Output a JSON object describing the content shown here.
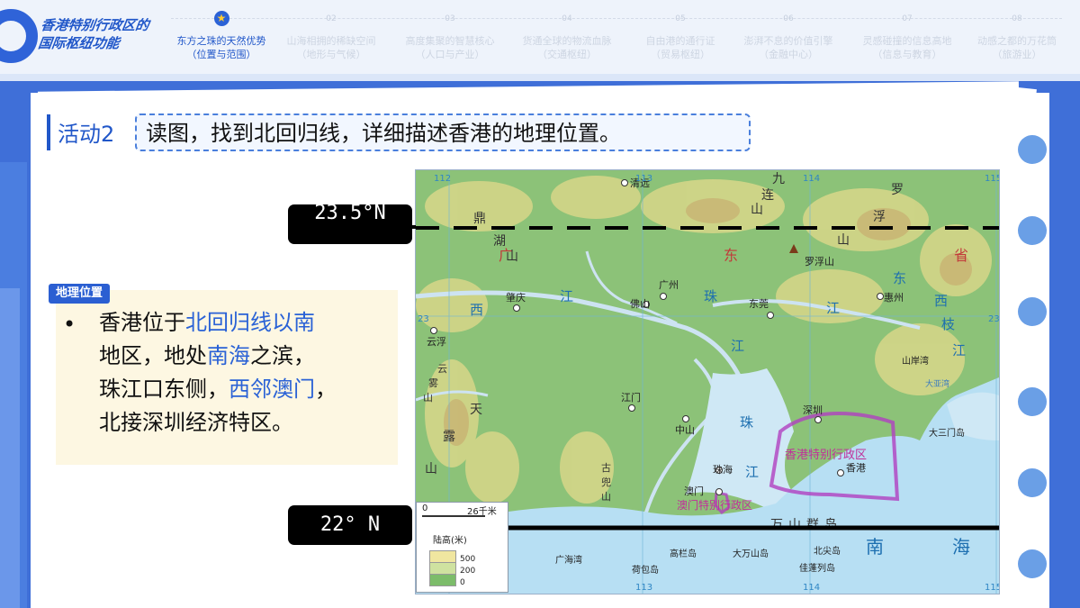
{
  "logo": {
    "text": "香港特别行政区的国际枢纽功能"
  },
  "nav": [
    {
      "num": "",
      "title": "东方之珠的天然优势",
      "sub": "（位置与范围）",
      "active": true
    },
    {
      "num": "02",
      "title": "山海相拥的稀缺空间",
      "sub": "（地形与气候）"
    },
    {
      "num": "03",
      "title": "高度集聚的智慧核心",
      "sub": "（人口与产业）"
    },
    {
      "num": "04",
      "title": "货通全球的物流血脉",
      "sub": "（交通枢纽）"
    },
    {
      "num": "05",
      "title": "自由港的通行证",
      "sub": "（贸易枢纽）"
    },
    {
      "num": "06",
      "title": "澎湃不息的价值引擎",
      "sub": "（金融中心）"
    },
    {
      "num": "07",
      "title": "灵感碰撞的信息高地",
      "sub": "（信息与教育）"
    },
    {
      "num": "08",
      "title": "动感之都的万花筒",
      "sub": "（旅游业）"
    }
  ],
  "activity": {
    "label": "活动2",
    "text": "读图，找到北回归线，详细描述香港的地理位置。"
  },
  "geo": {
    "tag": "地理位置",
    "bullet": "•",
    "line1_a": "香港位于",
    "line1_b": "北回归线以南",
    "line2_a": "地区，地处",
    "line2_b": "南海",
    "line2_c": "之滨，",
    "line3_a": "珠江口东侧，",
    "line3_b": "西邻澳门",
    "line3_c": "，",
    "line4": "北接深圳经济特区。"
  },
  "labels": {
    "tropic": "23.5°N",
    "lat22": "22° N"
  },
  "map": {
    "cities": [
      "清远",
      "广州",
      "佛山",
      "肇庆",
      "东莞",
      "惠州",
      "深圳",
      "香港",
      "江门",
      "中山",
      "珠海",
      "澳门",
      "云浮"
    ],
    "mountain": "罗浮山",
    "big": {
      "guang": "广",
      "dong": "东",
      "sheng": "省",
      "xi1": "西",
      "jiang1": "江",
      "zhu": "珠",
      "jiang2": "江",
      "zhu2": "珠",
      "jiang3": "江",
      "nan": "南",
      "hai": "海",
      "xi2": "西",
      "zhi": "枝",
      "jiang4": "江",
      "dong2": "东",
      "jiang5": "江",
      "shan": "山",
      "hu": "湖",
      "ding": "鼎",
      "jiu": "九",
      "lian": "连",
      "shan2": "山",
      "luo": "罗",
      "fu": "浮",
      "shan3": "山",
      "yun": "云",
      "wu": "雾",
      "shan4": "山",
      "tian": "天",
      "lu": "露",
      "shan5": "山",
      "gu": "古",
      "dou": "兜",
      "shan6": "山",
      "wan": "万",
      "shan7": "山",
      "qun": "群",
      "dao": "岛"
    },
    "sar_hk": "香港特别行政区",
    "sar_mo": "澳门特别行政区",
    "islands": [
      "大三门岛",
      "高栏岛",
      "大万山岛",
      "北尖岛",
      "荷包岛",
      "佳蓬列岛"
    ],
    "shanan": "山岸湾",
    "guanghai": "广海湾",
    "dapeng": "大亚湾",
    "grid_lon": [
      "112",
      "113",
      "114",
      "115"
    ],
    "grid_lat": [
      "23"
    ],
    "legend_title": "陆高(米)",
    "legend_values": [
      "500",
      "200",
      "0"
    ],
    "scale_zero": "0",
    "scale_km": "26千米"
  },
  "colors": {
    "accent": "#2157c9",
    "highlight": "#2a62d6",
    "sar": "#b040c0"
  }
}
